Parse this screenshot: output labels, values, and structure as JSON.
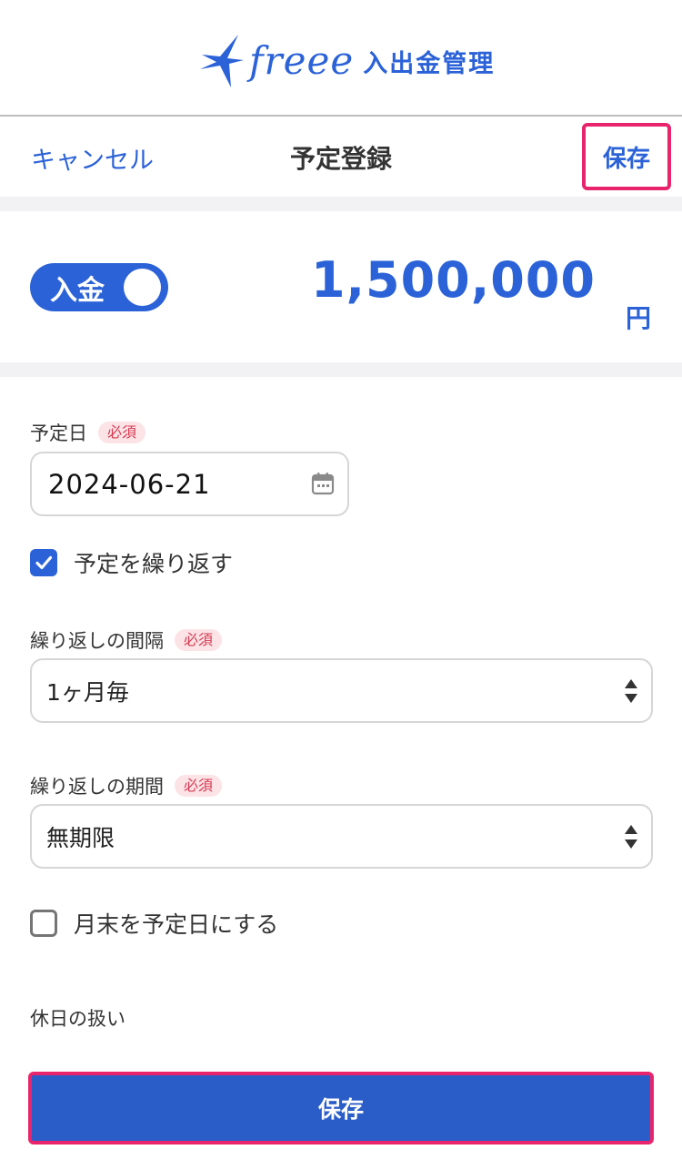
{
  "brand": {
    "logo_word": "freee",
    "product": "入出金管理"
  },
  "navbar": {
    "cancel_label": "キャンセル",
    "title": "予定登録",
    "save_label": "保存"
  },
  "amount": {
    "type_toggle_label": "入金",
    "value": "1,500,000",
    "unit": "円"
  },
  "form": {
    "required_badge": "必須",
    "scheduled_date": {
      "label": "予定日",
      "value": "2024-06-21"
    },
    "repeat": {
      "label": "予定を繰り返す",
      "checked": true
    },
    "repeat_interval": {
      "label": "繰り返しの間隔",
      "value": "1ヶ月毎"
    },
    "repeat_period": {
      "label": "繰り返しの期間",
      "value": "無期限"
    },
    "month_end": {
      "label": "月末を予定日にする",
      "checked": false
    },
    "holiday_handling": {
      "label": "休日の扱い"
    }
  },
  "footer": {
    "save_label": "保存"
  },
  "colors": {
    "accent": "#2b62d8",
    "button": "#2b5dc9",
    "highlight_border": "#e8256c",
    "required_bg": "#fbe3e6",
    "required_text": "#d83a52"
  },
  "icons": [
    "freee-bird-logo-icon",
    "calendar-icon",
    "checkmark-icon",
    "select-arrows-icon"
  ]
}
